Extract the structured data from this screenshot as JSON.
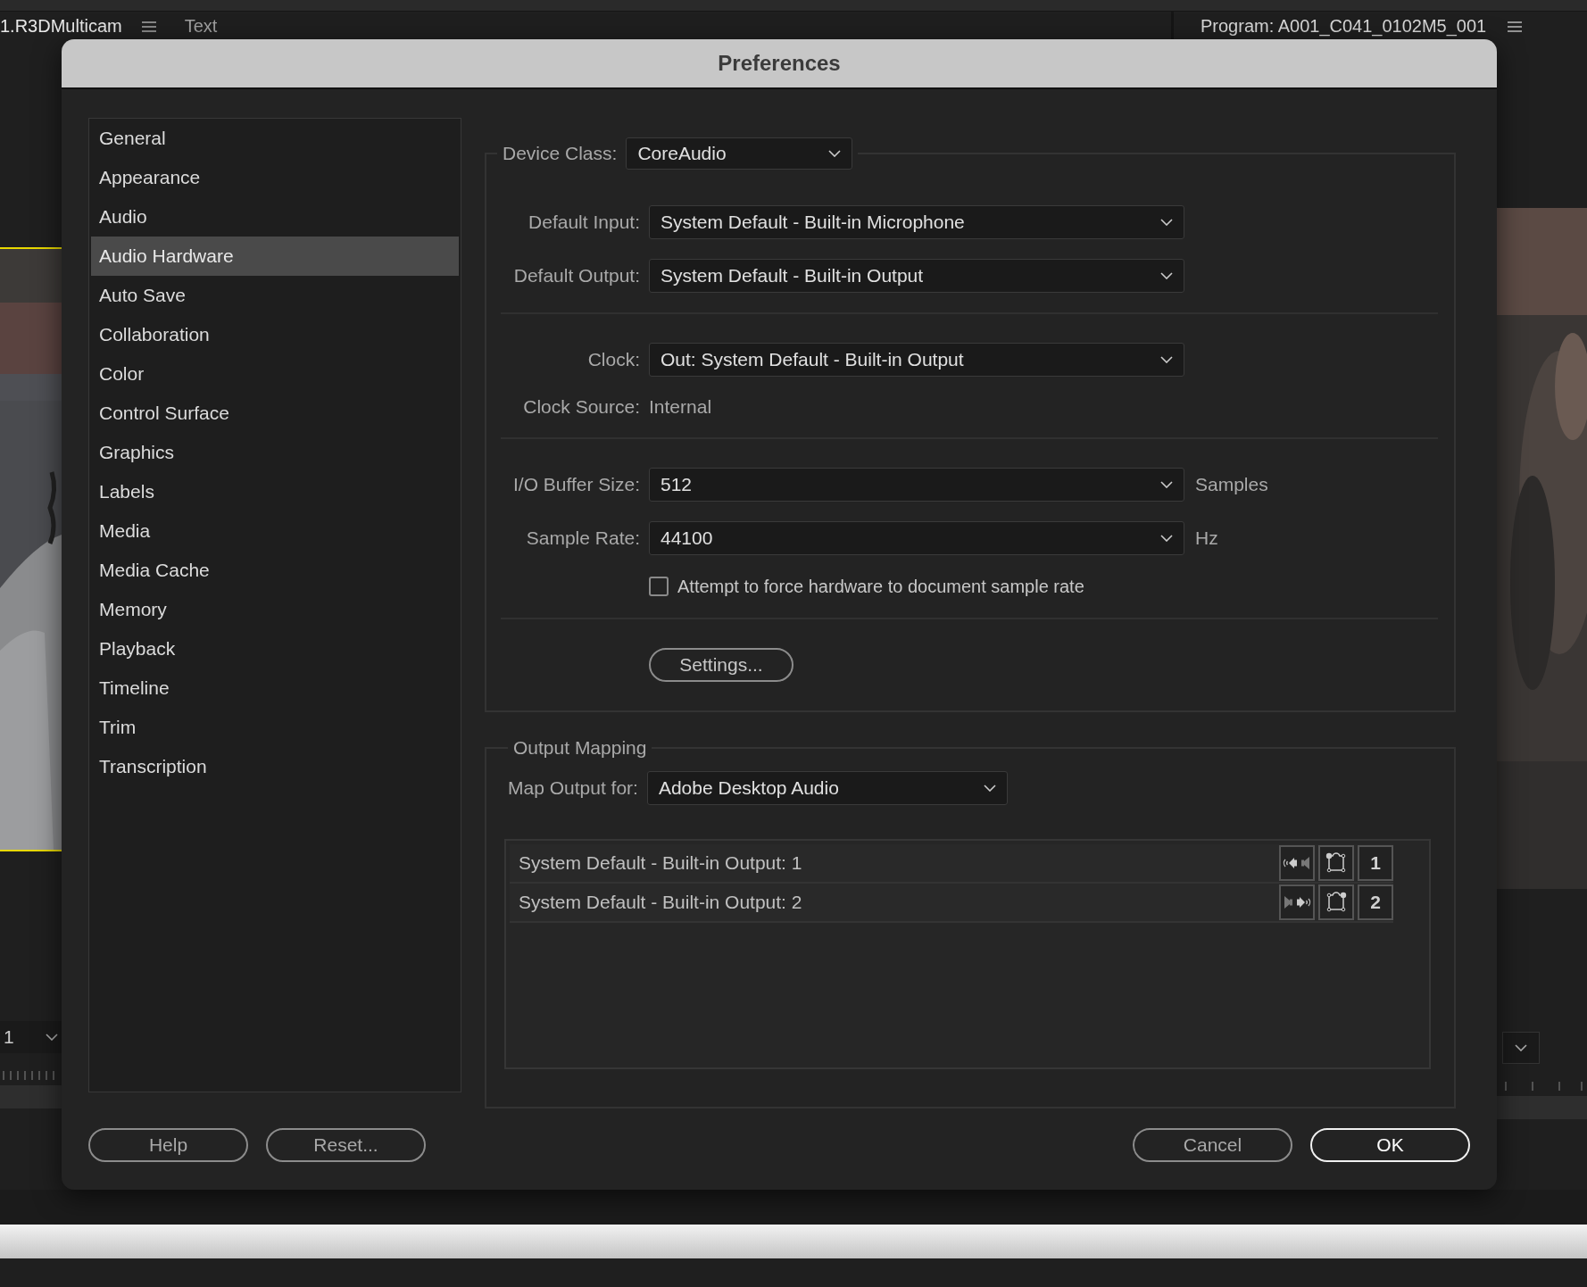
{
  "background": {
    "source_tab": "1.R3DMulticam",
    "text_tab": "Text",
    "program_title": "Program: A001_C041_0102M5_001",
    "source_zoom": "1"
  },
  "dialog": {
    "title": "Preferences"
  },
  "sidebar": {
    "items": [
      {
        "label": "General",
        "selected": false
      },
      {
        "label": "Appearance",
        "selected": false
      },
      {
        "label": "Audio",
        "selected": false
      },
      {
        "label": "Audio Hardware",
        "selected": true
      },
      {
        "label": "Auto Save",
        "selected": false
      },
      {
        "label": "Collaboration",
        "selected": false
      },
      {
        "label": "Color",
        "selected": false
      },
      {
        "label": "Control Surface",
        "selected": false
      },
      {
        "label": "Graphics",
        "selected": false
      },
      {
        "label": "Labels",
        "selected": false
      },
      {
        "label": "Media",
        "selected": false
      },
      {
        "label": "Media Cache",
        "selected": false
      },
      {
        "label": "Memory",
        "selected": false
      },
      {
        "label": "Playback",
        "selected": false
      },
      {
        "label": "Timeline",
        "selected": false
      },
      {
        "label": "Trim",
        "selected": false
      },
      {
        "label": "Transcription",
        "selected": false
      }
    ]
  },
  "device": {
    "label": "Device Class:",
    "value": "CoreAudio",
    "sections": [
      [
        {
          "kind": "select",
          "label": "Default Input:",
          "value": "System Default - Built-in Microphone"
        },
        {
          "kind": "select",
          "label": "Default Output:",
          "value": "System Default - Built-in Output"
        }
      ],
      [
        {
          "kind": "select",
          "label": "Clock:",
          "value": "Out: System Default - Built-in Output"
        },
        {
          "kind": "text",
          "label": "Clock Source:",
          "value": "Internal"
        }
      ],
      [
        {
          "kind": "select",
          "label": "I/O Buffer Size:",
          "value": "512",
          "unit": "Samples"
        },
        {
          "kind": "select",
          "label": "Sample Rate:",
          "value": "44100",
          "unit": "Hz"
        },
        {
          "kind": "checkbox",
          "label": "Attempt to force hardware to document sample rate",
          "checked": false
        }
      ],
      [
        {
          "kind": "button",
          "label": "Settings..."
        }
      ]
    ]
  },
  "output_mapping": {
    "title": "Output Mapping",
    "label": "Map Output for:",
    "value": "Adobe Desktop Audio",
    "channels": [
      {
        "name": "System Default - Built-in Output: 1",
        "number": "1",
        "kind": "left"
      },
      {
        "name": "System Default - Built-in Output: 2",
        "number": "2",
        "kind": "right"
      }
    ]
  },
  "footer": {
    "left_buttons": [
      "Help",
      "Reset..."
    ],
    "right_buttons": [
      {
        "label": "Cancel",
        "default": false
      },
      {
        "label": "OK",
        "default": true
      }
    ]
  }
}
